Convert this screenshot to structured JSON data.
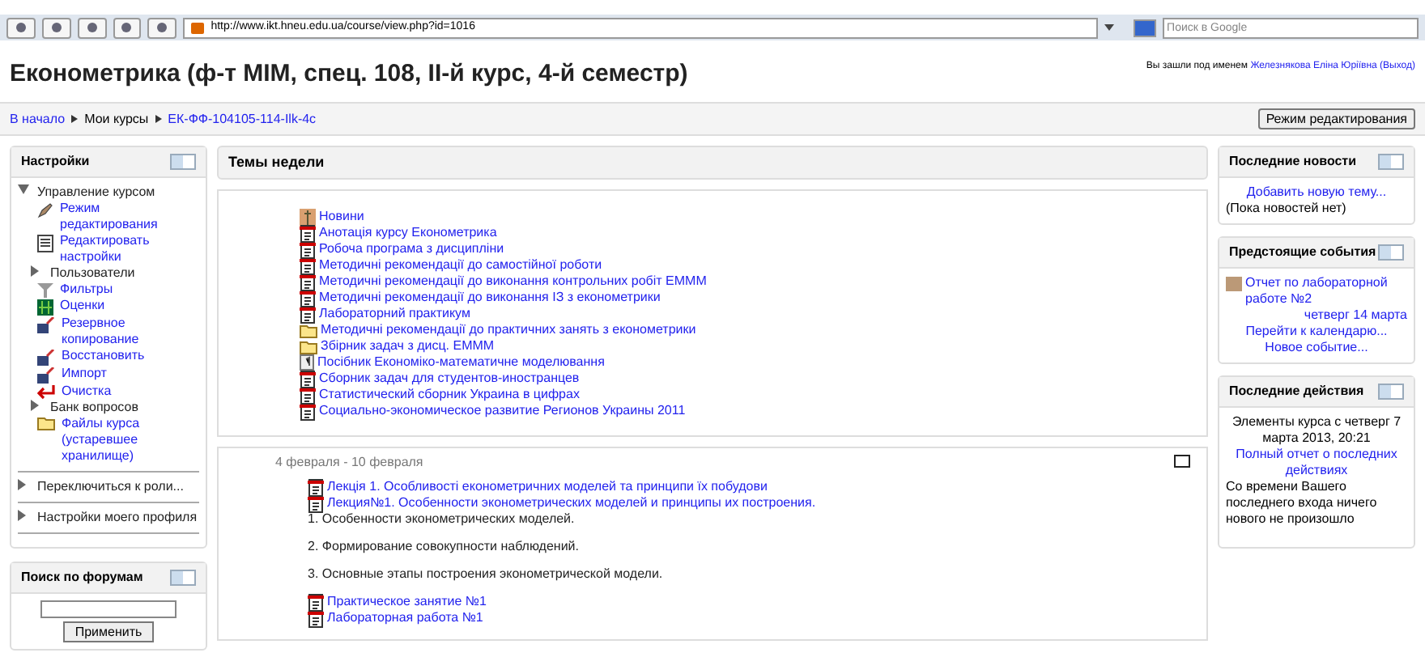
{
  "browser": {
    "url": "http://www.ikt.hneu.edu.ua/course/view.php?id=1016",
    "search": {
      "placeholder": "Поиск в Google"
    }
  },
  "header": {
    "title": "Економетрика (ф-т МІМ, спец. 108, ІІ-й курс, 4-й семестр)",
    "login_text": "Вы зашли под именем",
    "user": "Железнякова Еліна Юріївна",
    "logout": "(Выход)"
  },
  "breadcrumb": [
    {
      "label": "В начало",
      "link": true
    },
    {
      "label": "Мои курсы",
      "link": false
    },
    {
      "label": "ЕК-ФФ-104105-114-Ilk-4c",
      "link": true
    }
  ],
  "edit_button": "Режим редактирования",
  "settings": {
    "title": "Настройки",
    "tree": [
      {
        "label": "Управление курсом",
        "kind": "branch",
        "expanded": true,
        "children": [
          {
            "label": "Режим редактирования",
            "kind": "edit"
          },
          {
            "label": "Редактировать настройки",
            "kind": "doc"
          },
          {
            "label": "Пользователи",
            "kind": "branch",
            "expanded": false
          },
          {
            "label": "Фильтры",
            "kind": "filter"
          },
          {
            "label": "Оценки",
            "kind": "grades"
          },
          {
            "label": "Резервное копирование",
            "kind": "backup"
          },
          {
            "label": "Восстановить",
            "kind": "backup"
          },
          {
            "label": "Импорт",
            "kind": "backup"
          },
          {
            "label": "Очистка",
            "kind": "reset"
          },
          {
            "label": "Банк вопросов",
            "kind": "branch",
            "expanded": false
          },
          {
            "label": "Файлы курса (устаревшее хранилище)",
            "kind": "folder"
          }
        ]
      },
      {
        "label": "Переключиться к роли...",
        "kind": "branch",
        "expanded": false
      },
      {
        "label": "Настройки моего профиля",
        "kind": "branch",
        "expanded": false
      }
    ]
  },
  "forum_search": {
    "title": "Поиск по форумам",
    "button": "Применить"
  },
  "topics": {
    "title": "Темы недели",
    "items": [
      {
        "label": "Новини",
        "kind": "forum"
      },
      {
        "label": "Анотація курсу Економетрика",
        "kind": "pdf"
      },
      {
        "label": "Робоча програма з дисципліни",
        "kind": "pdf"
      },
      {
        "label": "Методичні рекомендації до самостійної роботи",
        "kind": "pdf"
      },
      {
        "label": "Методичні рекомендації до виконання контрольних робіт ЕМММ",
        "kind": "pdf"
      },
      {
        "label": "Методичні рекомендації до виконання ІЗ з економетрики",
        "kind": "pdf"
      },
      {
        "label": "Лабораторний практикум",
        "kind": "pdf"
      },
      {
        "label": "Методичні рекомендації до практичних занять з економетрики",
        "kind": "folder"
      },
      {
        "label": "Збірник задач з дисц. ЕМММ",
        "kind": "folder"
      },
      {
        "label": "Посібник Економіко-математичне моделювання",
        "kind": "page"
      },
      {
        "label": "Сборник задач для студентов-иностранцев",
        "kind": "pdf"
      },
      {
        "label": "Статистический сборник Украина в цифрах",
        "kind": "pdf"
      },
      {
        "label": "Социально-экономическое развитие Регионов Украины 2011",
        "kind": "pdf"
      }
    ]
  },
  "week": {
    "dates": "4 февраля - 10 февраля",
    "items": [
      {
        "label": "Лекція 1. Особливості економетричних моделей та принципи їх побудови",
        "kind": "pdf"
      },
      {
        "label": "Лекция№1. Особенности эконометрических моделей и принципы их построения.",
        "kind": "pdf"
      },
      {
        "number": "1.",
        "label": "Особенности эконометрических моделей.",
        "kind": "text"
      },
      {
        "number": "2.",
        "label": "Формирование совокупности наблюдений.",
        "kind": "text"
      },
      {
        "number": "3.",
        "label": "Основные этапы построения эконометрической модели.",
        "kind": "text"
      },
      {
        "label": "Практическое занятие №1",
        "kind": "pdf"
      },
      {
        "label": "Лабораторная работа №1",
        "kind": "pdf"
      }
    ]
  },
  "news": {
    "title": "Последние новости",
    "link": "Добавить новую тему...",
    "note": "(Пока новостей нет)"
  },
  "events": {
    "title": "Предстоящие события",
    "event": "Отчет по лабораторной работе №2",
    "date": "четверг 14 марта",
    "links": [
      "Перейти к календарю...",
      "Новое событие..."
    ]
  },
  "activity": {
    "title": "Последние действия",
    "since": "Элементы курса с четверг 7 марта 2013, 20:21",
    "link": "Полный отчет о последних действиях",
    "note": "Со времени Вашего последнего входа ничего нового не произошло"
  }
}
